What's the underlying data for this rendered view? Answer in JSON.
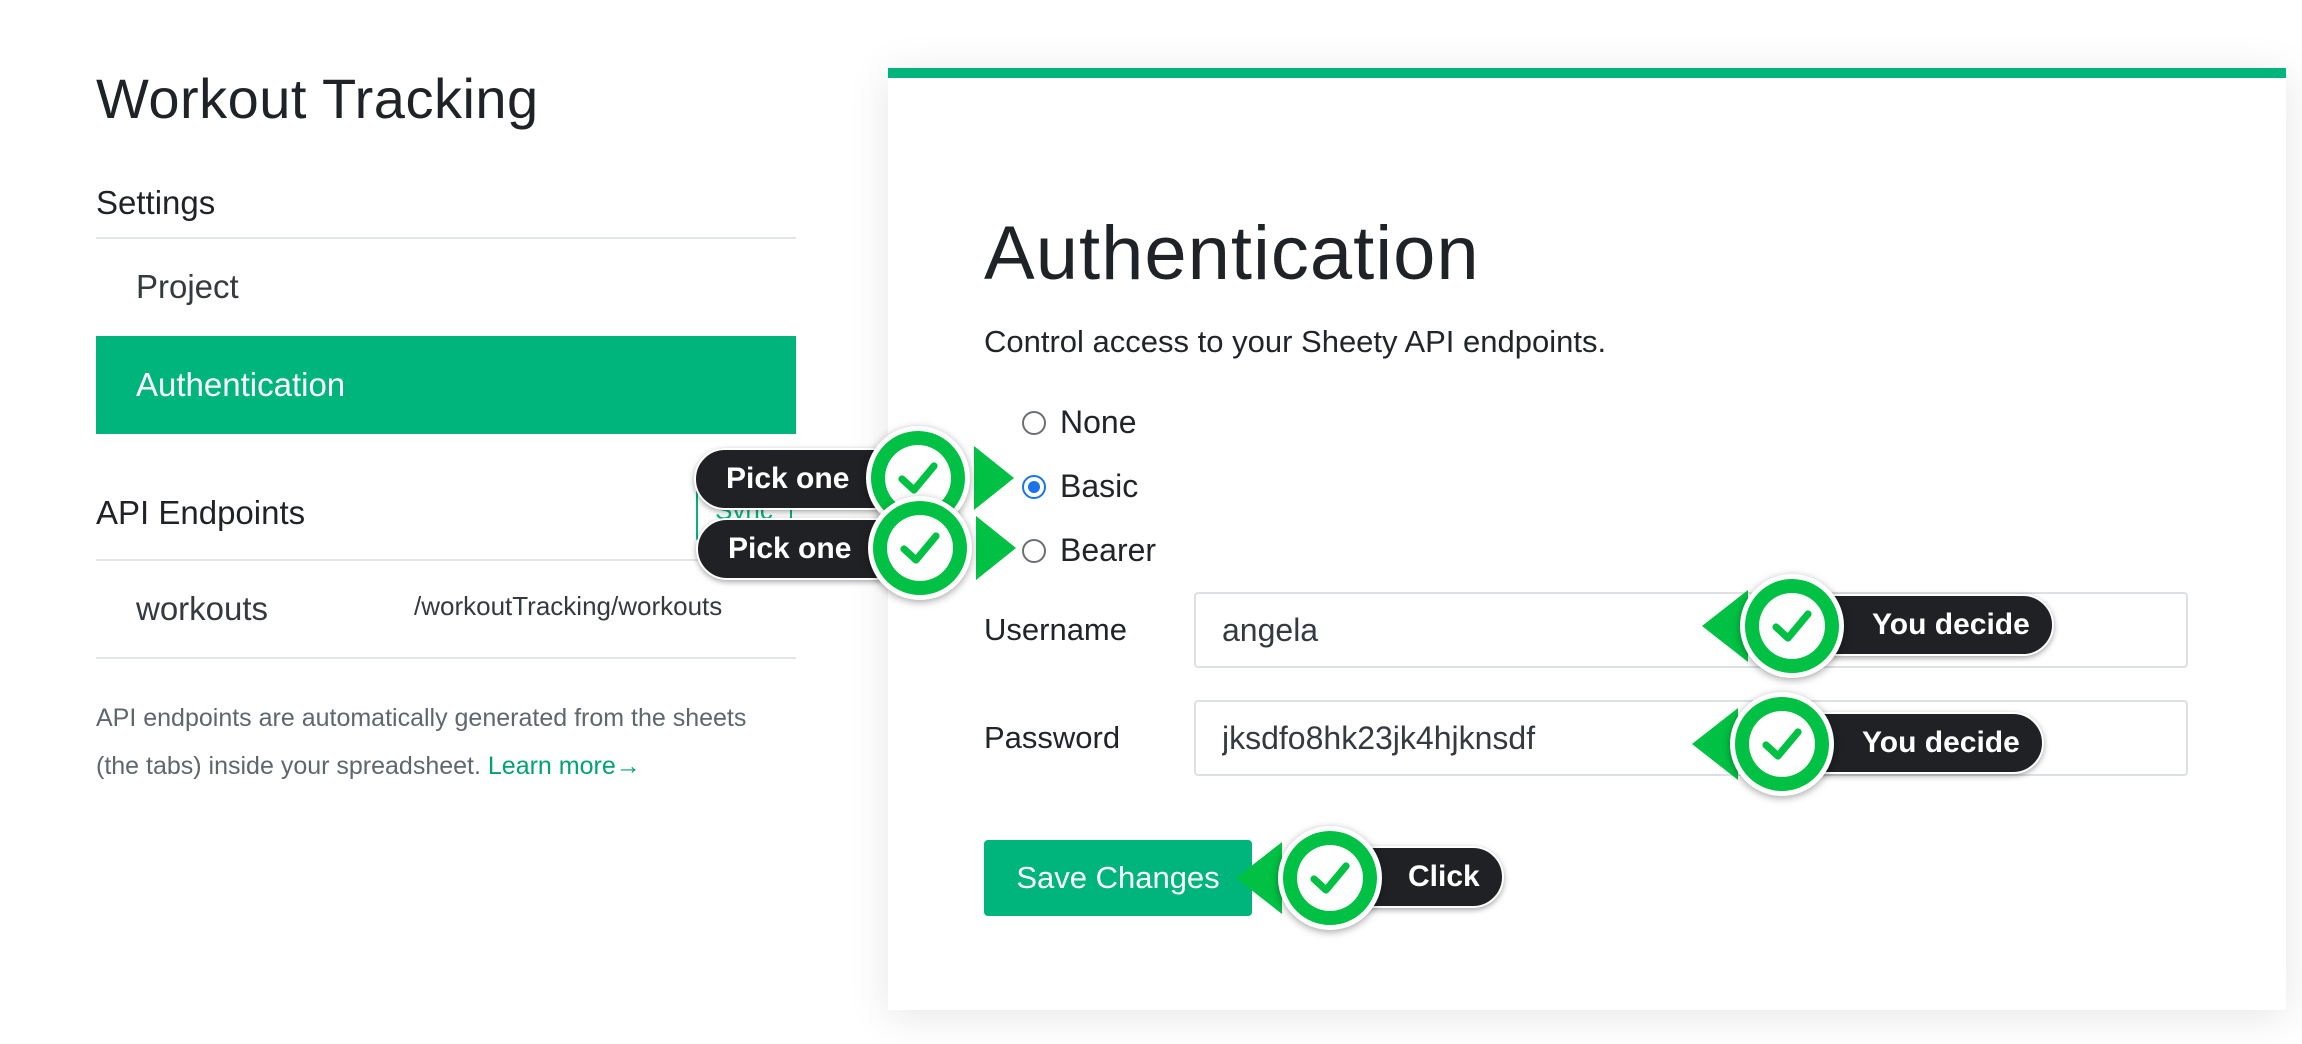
{
  "app": {
    "title": "Workout Tracking"
  },
  "sidebar": {
    "settings_heading": "Settings",
    "items": [
      {
        "label": "Project"
      },
      {
        "label": "Authentication"
      }
    ],
    "endpoints_heading": "API Endpoints",
    "sync_label": "Sync",
    "endpoints": [
      {
        "name": "workouts",
        "path": "/workoutTracking/workouts"
      }
    ],
    "help_text": "API endpoints are automatically generated from the sheets (the tabs) inside your spreadsheet.",
    "learn_more": "Learn more→"
  },
  "panel": {
    "title": "Authentication",
    "description": "Control access to your Sheety API endpoints.",
    "options": [
      {
        "label": "None",
        "checked": false
      },
      {
        "label": "Basic",
        "checked": true
      },
      {
        "label": "Bearer",
        "checked": false
      }
    ],
    "username_label": "Username",
    "username_value": "angela",
    "password_label": "Password",
    "password_value": "jksdfo8hk23jk4hjknsdf",
    "save_label": "Save Changes"
  },
  "annotations": {
    "pick_one": "Pick one",
    "you_decide": "You decide",
    "click": "Click"
  },
  "colors": {
    "accent": "#00b57c",
    "badge_green": "#00c143",
    "badge_dark": "#1f2124",
    "radio_blue": "#1a73e8"
  }
}
